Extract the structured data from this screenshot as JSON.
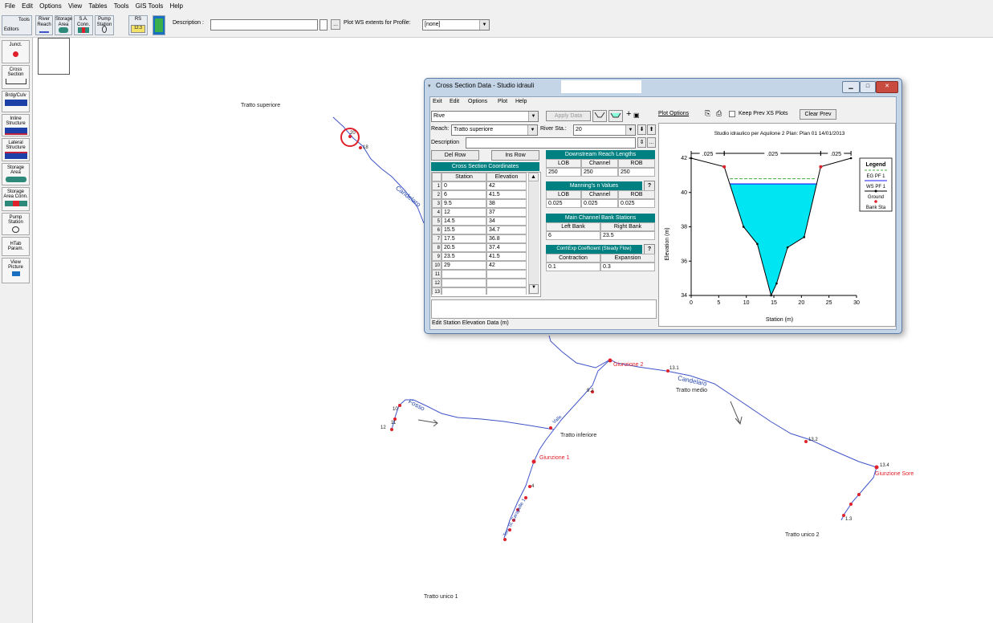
{
  "menubar": {
    "items": [
      "File",
      "Edit",
      "Options",
      "View",
      "Tables",
      "Tools",
      "GIS Tools",
      "Help"
    ]
  },
  "toolbar": {
    "tools_label": "Tools",
    "editors_label": "Editors",
    "buttons": [
      {
        "label": "River\nReach"
      },
      {
        "label": "Storage\nArea"
      },
      {
        "label": "S.A.\nConn."
      },
      {
        "label": "Pump\nStation"
      },
      {
        "label": "RS"
      }
    ],
    "rs_sub": "12.3",
    "description_label": "Description :",
    "description_value": "",
    "ellipsis": "...",
    "plot_ws_label": "Plot WS extents for Profile:",
    "profile_value": "[none]"
  },
  "palette": {
    "items": [
      {
        "label": "Junct."
      },
      {
        "label": "Cross\nSection"
      },
      {
        "label": "Brdg/Culv"
      },
      {
        "label": "Inline\nStructure"
      },
      {
        "label": "Lateral\nStructure"
      },
      {
        "label": "Storage\nArea"
      },
      {
        "label": "Storage\nArea Conn."
      },
      {
        "label": "Pump\nStation"
      },
      {
        "label": "HTab\nParam."
      },
      {
        "label": "View\nPicture"
      }
    ]
  },
  "map": {
    "reach_labels": [
      "Tratto superiore",
      "Tratto medio",
      "Tratto inferiore",
      "Tratto unico 1",
      "Tratto unico 2"
    ],
    "junctions": [
      "Giunzione 2",
      "Giunzione 1",
      "Giunzione Sore"
    ],
    "river_names": [
      "Candelaro",
      "Candelaro",
      "Fosso",
      "Torr. Sl. Carapelle 1",
      "Valle"
    ],
    "stations": [
      "20",
      "18",
      "9.2",
      "13.1",
      "13.2",
      "13.4",
      "12",
      "11",
      "10",
      "4",
      "1.3"
    ],
    "colors": {
      "river": "#3f54c8",
      "station": "#e0202a",
      "highlight": "#e0202a"
    }
  },
  "dialog": {
    "title": "Cross Section Data - Studio idrauli",
    "menu": [
      "Exit",
      "Edit",
      "Options",
      "Plot",
      "Help"
    ],
    "river_value": "Rive",
    "apply_label": "Apply Data",
    "reach_label": "Reach:",
    "reach_value": "Tratto superiore",
    "rs_label": "River Sta.:",
    "rs_value": "20",
    "description_label": "Description",
    "del_row": "Del Row",
    "ins_row": "Ins Row",
    "xs_header": "Cross Section Coordinates",
    "col_station": "Station",
    "col_elevation": "Elevation",
    "rows": [
      {
        "n": "1",
        "station": "0",
        "elevation": "42"
      },
      {
        "n": "2",
        "station": "6",
        "elevation": "41.5"
      },
      {
        "n": "3",
        "station": "9.5",
        "elevation": "38"
      },
      {
        "n": "4",
        "station": "12",
        "elevation": "37"
      },
      {
        "n": "5",
        "station": "14.5",
        "elevation": "34"
      },
      {
        "n": "6",
        "station": "15.5",
        "elevation": "34.7"
      },
      {
        "n": "7",
        "station": "17.5",
        "elevation": "36.8"
      },
      {
        "n": "8",
        "station": "20.5",
        "elevation": "37.4"
      },
      {
        "n": "9",
        "station": "23.5",
        "elevation": "41.5"
      },
      {
        "n": "10",
        "station": "29",
        "elevation": "42"
      },
      {
        "n": "11",
        "station": "",
        "elevation": ""
      },
      {
        "n": "12",
        "station": "",
        "elevation": ""
      },
      {
        "n": "13",
        "station": "",
        "elevation": ""
      }
    ],
    "down_header": "Downstream Reach Lengths",
    "lob": "LOB",
    "channel": "Channel",
    "rob": "ROB",
    "reach_lengths": [
      "250",
      "250",
      "250"
    ],
    "mann_header": "Manning's n Values",
    "mann_values": [
      "0.025",
      "0.025",
      "0.025"
    ],
    "bank_header": "Main Channel Bank Stations",
    "left_bank": "Left Bank",
    "right_bank": "Right Bank",
    "bank_values": [
      "6",
      "23.5"
    ],
    "coef_header": "Cont\\Exp Coefficient (Steady Flow)",
    "contraction": "Contraction",
    "expansion": "Expansion",
    "coef_values": [
      "0.1",
      "0.3"
    ],
    "status": "Edit Station Elevation Data (m)",
    "plot_options": "Plot Options",
    "keep_prev": "Keep Prev XS Plots",
    "clear_prev": "Clear Prev",
    "help_btn": "?"
  },
  "chart_data": {
    "type": "area",
    "title": "Studio idraulico per Aquilone 2    Plan: Plan 01   14/01/2013",
    "xlabel": "Station (m)",
    "ylabel": "Elevation (m)",
    "xlim": [
      0,
      30
    ],
    "ylim": [
      34,
      42
    ],
    "xticks": [
      "0",
      "5",
      "10",
      "15",
      "20",
      "25",
      "30"
    ],
    "yticks": [
      "34",
      "36",
      "38",
      "40",
      "42"
    ],
    "ground": {
      "x": [
        0,
        6,
        9.5,
        12,
        14.5,
        15.5,
        17.5,
        20.5,
        23.5,
        29
      ],
      "y": [
        42,
        41.5,
        38,
        37,
        34,
        34.7,
        36.8,
        37.4,
        41.5,
        42
      ]
    },
    "bank_stations": [
      6,
      23.5
    ],
    "ws_elevation": 40.5,
    "eg_elevation": 40.8,
    "n_labels": [
      ".025",
      ".025",
      ".025"
    ],
    "legend": {
      "title": "Legend",
      "entries": [
        "EG PF 1",
        "WS PF 1",
        "Ground",
        "Bank Sta"
      ]
    },
    "colors": {
      "water": "#00e5f2",
      "eg": "#3fae3f",
      "ws": "#1a1aff",
      "ground": "#000000",
      "bank": "#e0202a"
    }
  }
}
